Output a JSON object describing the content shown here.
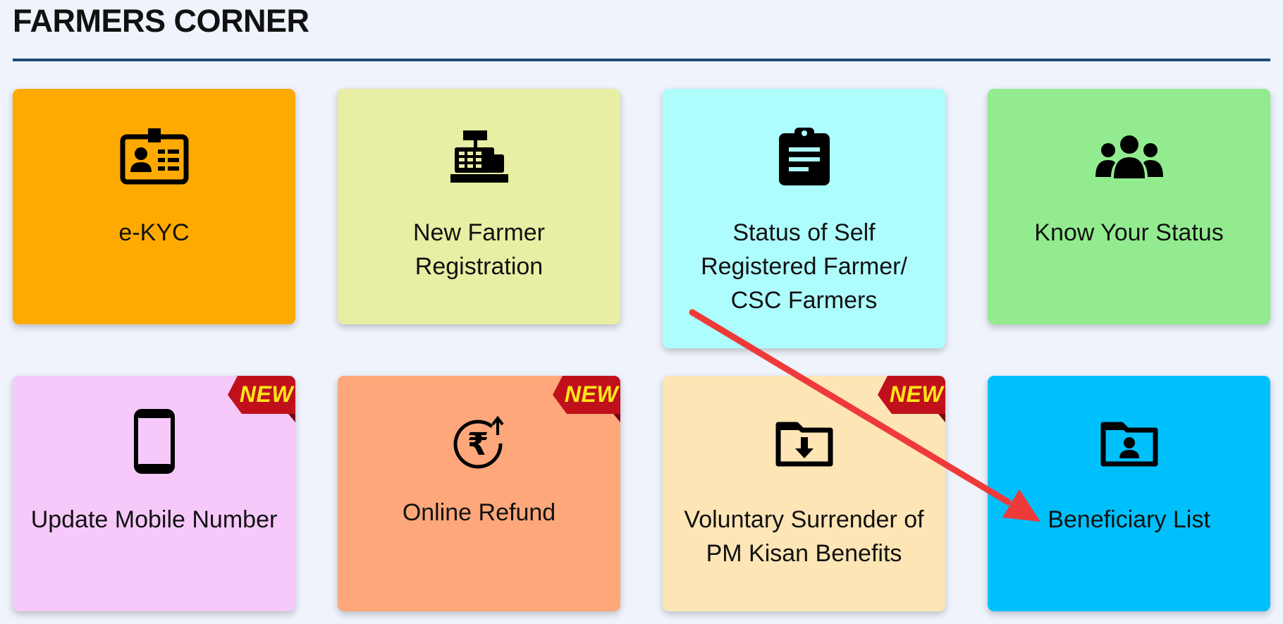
{
  "header": {
    "title": "FARMERS CORNER"
  },
  "badge_text": "NEW",
  "tiles": [
    {
      "label": "e-KYC",
      "icon": "id-card-icon",
      "color": "#ffaa00",
      "is_new": false
    },
    {
      "label": "New Farmer\nRegistration",
      "icon": "cash-register-icon",
      "color": "#e8eea3",
      "is_new": false
    },
    {
      "label": "Status of Self\nRegistered Farmer/\nCSC Farmers",
      "icon": "clipboard-icon",
      "color": "#adfdfd",
      "is_new": false
    },
    {
      "label": "Know Your Status",
      "icon": "users-icon",
      "color": "#92ec8f",
      "is_new": false
    },
    {
      "label": "Update Mobile Number",
      "icon": "mobile-phone-icon",
      "color": "#f6c9fa",
      "is_new": true
    },
    {
      "label": "Online Refund",
      "icon": "rupee-refund-icon",
      "color": "#fda77a",
      "is_new": true
    },
    {
      "label": "Voluntary Surrender of\nPM Kisan Benefits",
      "icon": "folder-download-icon",
      "color": "#fde5b5",
      "is_new": true
    },
    {
      "label": "Beneficiary List",
      "icon": "folder-user-icon",
      "color": "#00c0fc",
      "is_new": false
    }
  ],
  "colors": {
    "title_rule": "#1f4e79",
    "badge_ribbon": "#c0101b",
    "badge_text": "#ffe61a",
    "annotation_arrow": "#ef3a3a",
    "background": "#eef3fc"
  }
}
